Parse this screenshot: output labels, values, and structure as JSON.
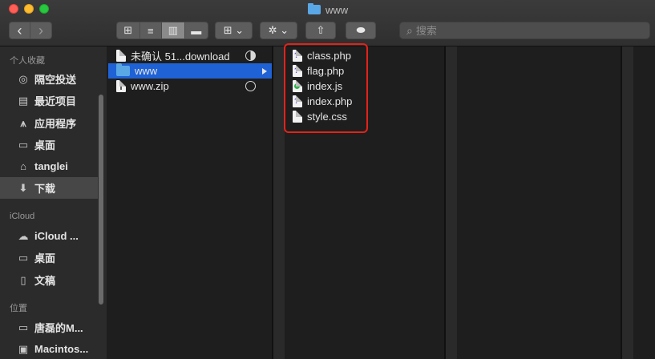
{
  "window": {
    "title": "www"
  },
  "toolbar": {
    "back_glyph": "‹",
    "forward_glyph": "›",
    "view_icon_glyph": "⊞",
    "view_list_glyph": "≡",
    "view_column_glyph": "▥",
    "view_gallery_glyph": "▬",
    "group_glyph": "⊞ ⌄",
    "action_glyph": "✲ ⌄",
    "share_glyph": "⇧",
    "tag_glyph": "⬬",
    "search_placeholder": "搜索",
    "search_icon_glyph": "⌕"
  },
  "sidebar": {
    "sections": [
      {
        "label": "个人收藏"
      },
      {
        "label": "iCloud"
      },
      {
        "label": "位置"
      }
    ],
    "items": [
      {
        "label": "隔空投送",
        "icon": "airdrop-icon",
        "glyph": "◎"
      },
      {
        "label": "最近项目",
        "icon": "recents-icon",
        "glyph": "▤"
      },
      {
        "label": "应用程序",
        "icon": "applications-icon",
        "glyph": "⩚"
      },
      {
        "label": "桌面",
        "icon": "desktop-icon",
        "glyph": "▭"
      },
      {
        "label": "tanglei",
        "icon": "home-icon",
        "glyph": "⌂"
      },
      {
        "label": "下载",
        "icon": "downloads-icon",
        "glyph": "⬇",
        "selected": true
      },
      {
        "label": "iCloud ...",
        "icon": "cloud-icon",
        "glyph": "☁"
      },
      {
        "label": "桌面",
        "icon": "desktop-icon",
        "glyph": "▭"
      },
      {
        "label": "文稿",
        "icon": "documents-icon",
        "glyph": "▯"
      },
      {
        "label": "唐磊的M...",
        "icon": "computer-icon",
        "glyph": "▭"
      },
      {
        "label": "Macintos...",
        "icon": "disk-icon",
        "glyph": "▣"
      }
    ]
  },
  "column1": {
    "items": [
      {
        "name": "未确认 51...download",
        "kind": "download",
        "progress": 0.5
      },
      {
        "name": "www",
        "kind": "folder",
        "selected": true
      },
      {
        "name": "www.zip",
        "kind": "zip",
        "progress": 0.0
      }
    ]
  },
  "column2": {
    "items": [
      {
        "name": "class.php",
        "kind": "php"
      },
      {
        "name": "flag.php",
        "kind": "php"
      },
      {
        "name": "index.js",
        "kind": "js"
      },
      {
        "name": "index.php",
        "kind": "php"
      },
      {
        "name": "style.css",
        "kind": "css"
      }
    ]
  },
  "colors": {
    "selection": "#1f62d6",
    "folder": "#5aa7e6",
    "highlight": "#e2231a"
  }
}
